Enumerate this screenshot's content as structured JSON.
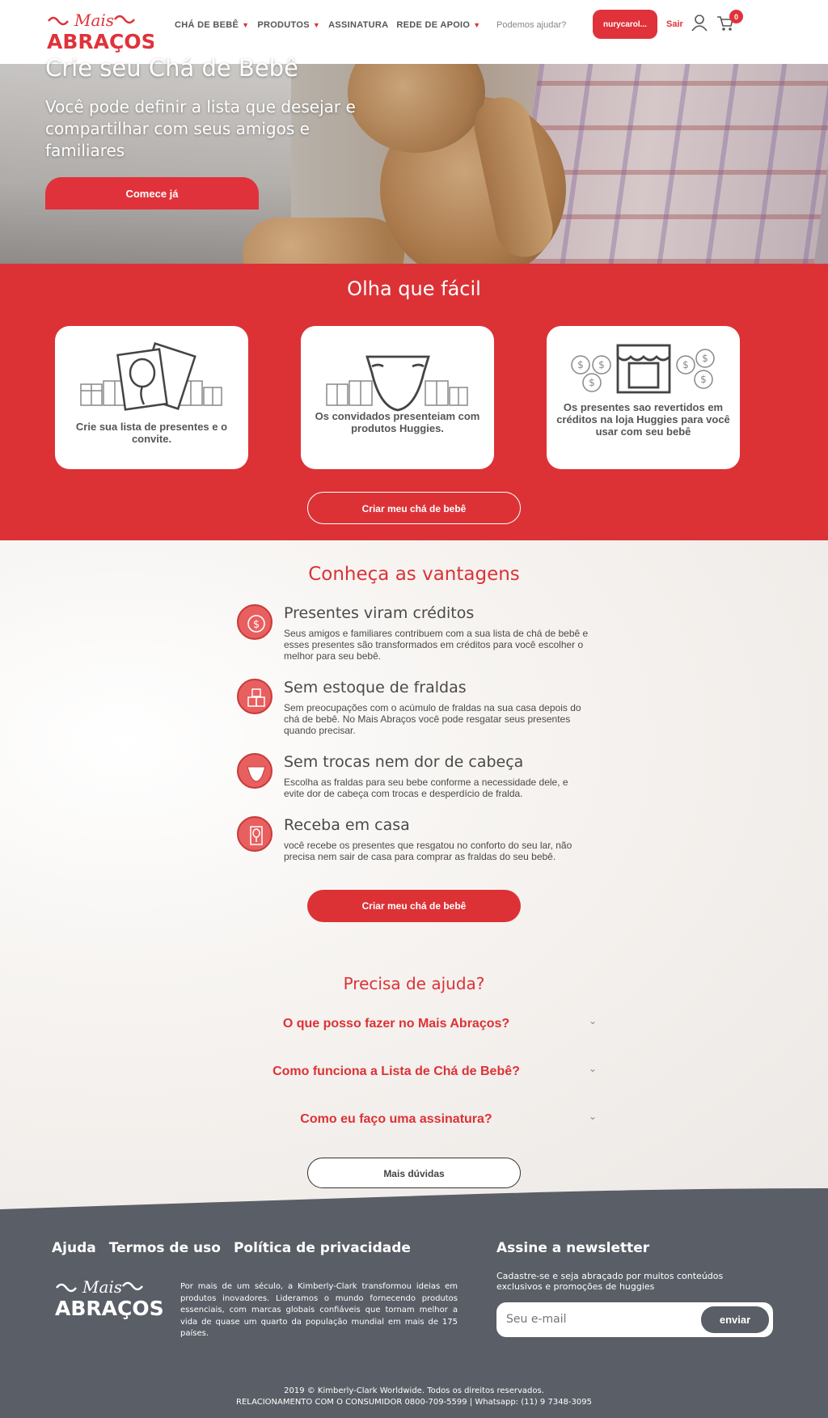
{
  "brand": {
    "logo_top": "Mais",
    "logo_bottom": "ABRAÇOS",
    "accent_color": "#dc3236",
    "footer_color": "#5a5e66"
  },
  "header": {
    "nav": [
      {
        "label": "CHÁ DE BEBÊ",
        "has_dropdown": true
      },
      {
        "label": "PRODUTOS",
        "has_dropdown": true
      },
      {
        "label": "ASSINATURA",
        "has_dropdown": false
      },
      {
        "label": "REDE DE APOIO",
        "has_dropdown": true
      }
    ],
    "help_link": "Podemos ajudar?",
    "user_button": "nurycarol...",
    "logout": "Sair",
    "cart_count": "0",
    "user_icon": "user-icon",
    "cart_icon": "cart-icon"
  },
  "hero": {
    "title": "Crie seu Chá de Bebê",
    "subtitle": "Você pode definir a lista que desejar e compartilhar com seus amigos e familiares",
    "cta": "Comece já"
  },
  "easy": {
    "title": "Olha que fácil",
    "steps": [
      {
        "text": "Crie sua lista de presentes e o convite.",
        "icon": "invitation-card-icon"
      },
      {
        "text": "Os convidados presenteiam com produtos Huggies.",
        "icon": "diaper-icon"
      },
      {
        "text": "Os presentes sao revertidos em créditos na loja Huggies para você usar com seu bebê",
        "icon": "store-coins-icon"
      }
    ],
    "cta": "Criar meu chá de bebê"
  },
  "advantages": {
    "title": "Conheça as vantagens",
    "items": [
      {
        "title": "Presentes viram créditos",
        "desc": "Seus amigos e familiares contribuem com a sua lista de chá de bebê e esses presentes são transformados em créditos para você escolher o melhor para seu bebê.",
        "icon": "coin-icon"
      },
      {
        "title": "Sem estoque de fraldas",
        "desc": "Sem preocupações com o acúmulo de fraldas na sua casa depois do chá de bebê. No Mais Abraços você pode resgatar seus presentes quando precisar.",
        "icon": "boxes-icon"
      },
      {
        "title": "Sem trocas nem dor de cabeça",
        "desc": "Escolha as fraldas para seu bebe conforme a necessidade dele, e evite dor de cabeça com trocas e desperdício de fralda.",
        "icon": "diaper-icon"
      },
      {
        "title": "Receba em casa",
        "desc": "você recebe os presentes que resgatou no conforto do seu lar, não precisa nem sair de casa para comprar as fraldas do seu bebê.",
        "icon": "home-delivery-icon"
      }
    ],
    "cta": "Criar meu chá de bebê"
  },
  "faq": {
    "title": "Precisa de ajuda?",
    "questions": [
      "O que posso fazer no Mais Abraços?",
      "Como funciona a Lista de Chá de Bebê?",
      "Como eu faço uma assinatura?"
    ],
    "more": "Mais dúvidas"
  },
  "footer": {
    "links": [
      "Ajuda",
      "Termos de uso",
      "Política de privacidade"
    ],
    "about": "Por mais de um século, a Kimberly-Clark transformou ideias em produtos inovadores. Lideramos o mundo fornecendo produtos essenciais, com marcas globais confiáveis que tornam melhor a vida de quase um quarto da população mundial em mais de 175 países.",
    "newsletter_title": "Assine a newsletter",
    "newsletter_desc": "Cadastre-se e seja abraçado por muitos conteúdos exclusivos e promoções de huggies",
    "email_placeholder": "Seu e-mail",
    "send": "enviar",
    "copyright": "2019 © Kimberly-Clark Worldwide. Todos os direitos reservados.",
    "contact": "RELACIONAMENTO COM O CONSUMIDOR 0800-709-5599 | Whatsapp: (11) 9 7348-3095"
  }
}
